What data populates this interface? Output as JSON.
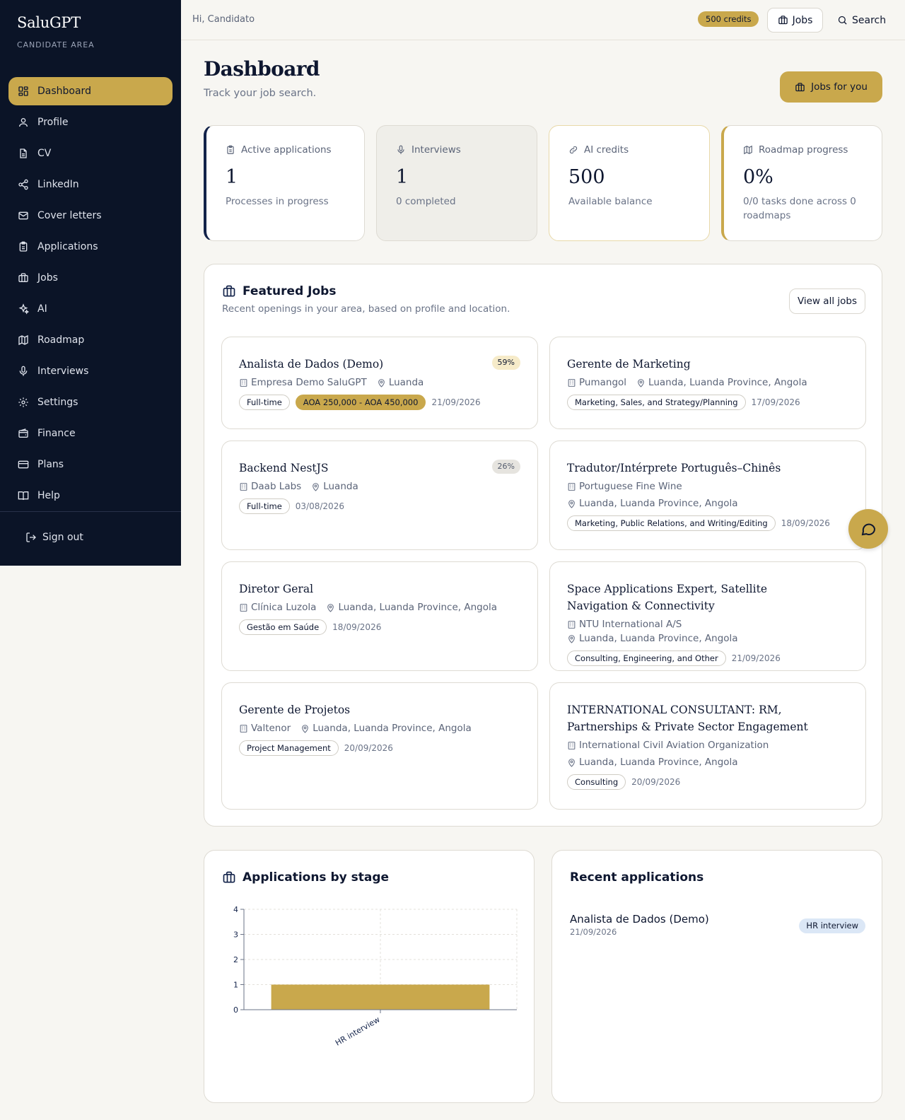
{
  "sidebar": {
    "brand": "SaluGPT",
    "subtitle": "CANDIDATE AREA",
    "items": [
      {
        "label": "Dashboard",
        "icon": "grid-icon"
      },
      {
        "label": "Profile",
        "icon": "user-icon"
      },
      {
        "label": "CV",
        "icon": "file-icon"
      },
      {
        "label": "LinkedIn",
        "icon": "share-icon"
      },
      {
        "label": "Cover letters",
        "icon": "mail-icon"
      },
      {
        "label": "Applications",
        "icon": "clipboard-icon"
      },
      {
        "label": "Jobs",
        "icon": "briefcase-icon"
      },
      {
        "label": "AI",
        "icon": "sparkles-icon"
      },
      {
        "label": "Roadmap",
        "icon": "map-icon"
      },
      {
        "label": "Interviews",
        "icon": "mic-icon"
      },
      {
        "label": "Settings",
        "icon": "gear-icon"
      },
      {
        "label": "Finance",
        "icon": "wallet-icon"
      },
      {
        "label": "Plans",
        "icon": "credit-card-icon"
      },
      {
        "label": "Help",
        "icon": "book-icon"
      }
    ],
    "active": "Dashboard",
    "signout": "Sign out"
  },
  "topbar": {
    "greeting": "Hi, Candidato",
    "credits": "500 credits",
    "jobs": "Jobs",
    "search": "Search"
  },
  "header": {
    "title": "Dashboard",
    "subtitle": "Track your job search.",
    "cta": "Jobs for you"
  },
  "stats": [
    {
      "label": "Active applications",
      "value": "1",
      "desc": "Processes in progress",
      "icon": "clipboard-icon"
    },
    {
      "label": "Interviews",
      "value": "1",
      "desc": "0 completed",
      "icon": "mic-icon"
    },
    {
      "label": "AI credits",
      "value": "500",
      "desc": "Available balance",
      "icon": "link-icon"
    },
    {
      "label": "Roadmap progress",
      "value": "0%",
      "desc": "0/0 tasks done across 0 roadmaps",
      "icon": "map-icon"
    }
  ],
  "featured": {
    "title": "Featured Jobs",
    "subtitle": "Recent openings in your area, based on profile and location.",
    "view_all": "View all jobs",
    "jobs": [
      {
        "title": "Analista de Dados (Demo)",
        "company": "Empresa Demo SaluGPT",
        "location": "Luanda",
        "tags": [
          "Full-time"
        ],
        "salary": "AOA 250,000 - AOA 450,000",
        "date": "21/09/2026",
        "match": "59%"
      },
      {
        "title": "Gerente de Marketing",
        "company": "Pumangol",
        "location": "Luanda, Luanda Province, Angola",
        "tags": [
          "Marketing, Sales, and Strategy/Planning"
        ],
        "date": "17/09/2026"
      },
      {
        "title": "Backend NestJS",
        "company": "Daab Labs",
        "location": "Luanda",
        "tags": [
          "Full-time"
        ],
        "date": "03/08/2026",
        "match": "26%"
      },
      {
        "title": "Tradutor/Intérprete Português–Chinês",
        "company": "Portuguese Fine Wine",
        "location": "Luanda, Luanda Province, Angola",
        "tags": [
          "Marketing, Public Relations, and Writing/Editing"
        ],
        "date": "18/09/2026"
      },
      {
        "title": "Diretor Geral",
        "company": "Clínica Luzola",
        "location": "Luanda, Luanda Province, Angola",
        "tags": [
          "Gestão em Saúde"
        ],
        "date": "18/09/2026"
      },
      {
        "title": "Space Applications Expert, Satellite Navigation & Connectivity",
        "company": "NTU International A/S",
        "location": "Luanda, Luanda Province, Angola",
        "tags": [
          "Consulting, Engineering, and Other"
        ],
        "date": "21/09/2026"
      },
      {
        "title": "Gerente de Projetos",
        "company": "Valtenor",
        "location": "Luanda, Luanda Province, Angola",
        "tags": [
          "Project Management"
        ],
        "date": "20/09/2026"
      },
      {
        "title": "INTERNATIONAL CONSULTANT: RM, Partnerships & Private Sector Engagement",
        "company": "International Civil Aviation Organization",
        "location": "Luanda, Luanda Province, Angola",
        "tags": [
          "Consulting"
        ],
        "date": "20/09/2026"
      }
    ]
  },
  "chart": {
    "title": "Applications by stage"
  },
  "chart_data": {
    "type": "bar",
    "categories": [
      "HR interview"
    ],
    "values": [
      1
    ],
    "ylim": [
      0,
      4
    ],
    "yticks": [
      0,
      1,
      2,
      3,
      4
    ],
    "grid": true,
    "color": "#c9a84c"
  },
  "recent": {
    "title": "Recent applications",
    "items": [
      {
        "name": "Analista de Dados (Demo)",
        "date": "21/09/2026",
        "stage": "HR interview"
      }
    ]
  },
  "colors": {
    "sidebar_bg": "#0b1427",
    "accent": "#c9a84c",
    "navy": "#13234a",
    "page_bg": "#f7f6f2"
  }
}
